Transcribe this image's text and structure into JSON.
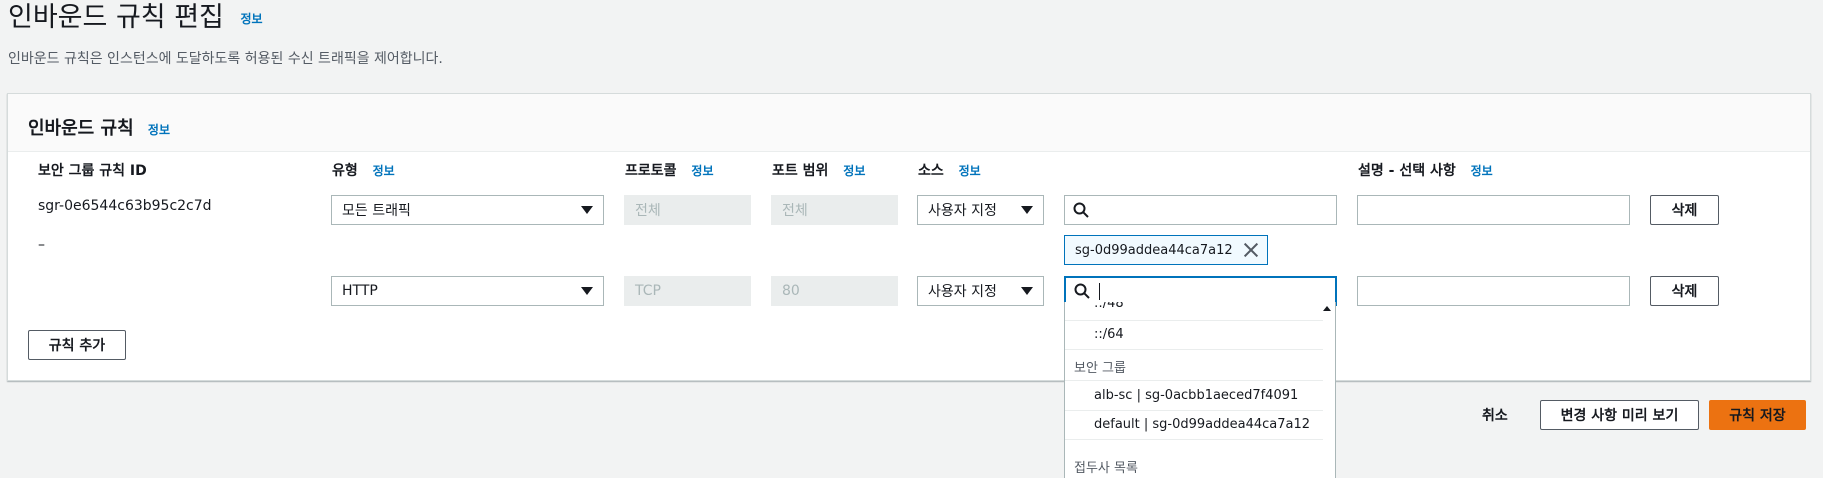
{
  "page": {
    "title": "인바운드 규칙 편집",
    "title_info": "정보",
    "description": "인바운드 규칙은 인스턴스에 도달하도록 허용된 수신 트래픽을 제어합니다."
  },
  "panel": {
    "title": "인바운드 규칙",
    "title_info": "정보",
    "columns": {
      "rule_id": "보안 그룹 규칙 ID",
      "type": "유형",
      "type_info": "정보",
      "protocol": "프로토콜",
      "protocol_info": "정보",
      "port_range": "포트 범위",
      "port_info": "정보",
      "source": "소스",
      "source_info": "정보",
      "description": "설명 - 선택 사항",
      "description_info": "정보"
    },
    "rows": [
      {
        "rule_id": "sgr-0e6544c63b95c2c7d",
        "type": "모든 트래픽",
        "protocol": "전체",
        "port_range": "전체",
        "source_type": "사용자 지정",
        "source_search": "",
        "source_token": "sg-0d99addea44ca7a12",
        "description": "",
        "delete_label": "삭제"
      },
      {
        "rule_id": "–",
        "type": "HTTP",
        "protocol": "TCP",
        "port_range": "80",
        "source_type": "사용자 지정",
        "source_search": "",
        "description": "",
        "delete_label": "삭제"
      }
    ],
    "add_rule_label": "규칙 추가"
  },
  "dropdown": {
    "items_top": [
      "::/48",
      "::/64"
    ],
    "group_security": "보안 그룹",
    "security_groups": [
      "alb-sc | sg-0acbb1aeced7f4091",
      "default | sg-0d99addea44ca7a12"
    ],
    "group_prefix": "접두사 목록"
  },
  "footer": {
    "cancel_label": "취소",
    "preview_label": "변경 사항 미리 보기",
    "save_label": "규칙 저장"
  },
  "icons": {
    "search": "search-icon",
    "close": "close-icon",
    "caret": "caret-down-icon"
  },
  "colors": {
    "link": "#0073bb",
    "primary": "#ec7211",
    "focus": "#0073bb"
  }
}
